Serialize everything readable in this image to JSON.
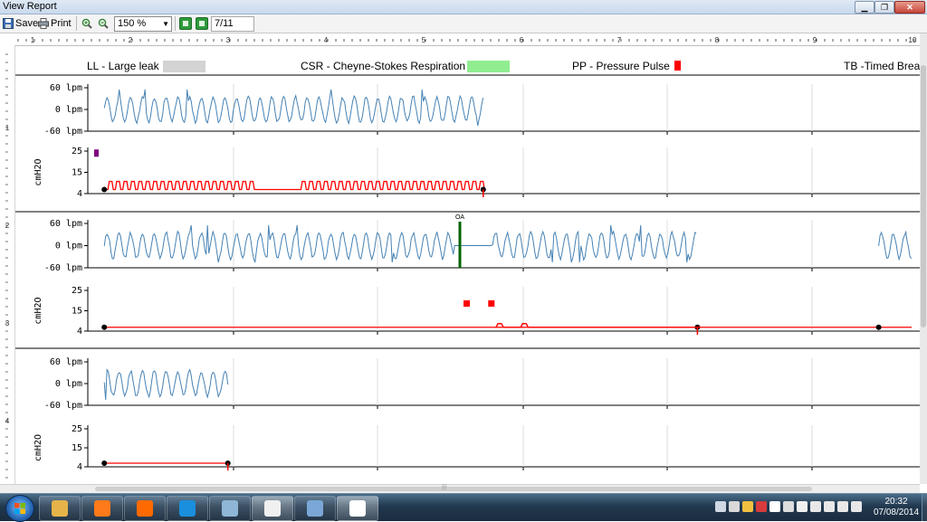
{
  "window": {
    "title": "View Report",
    "minimize_glyph": "▁",
    "maximize_glyph": "❐",
    "close_glyph": "✕"
  },
  "toolbar": {
    "save_label": "Save",
    "print_label": "Print",
    "zoom_in_icon": "zoom-in-icon",
    "zoom_out_icon": "zoom-out-icon",
    "zoom_value": "150 %",
    "page_indicator": "7/11"
  },
  "ruler": {
    "horizontal_labels": [
      "1",
      "2",
      "3",
      "4",
      "5",
      "6",
      "7",
      "8",
      "9",
      "10"
    ],
    "vertical_labels": [
      "1",
      "2",
      "3",
      "4"
    ]
  },
  "legend": [
    {
      "label": "LL - Large leak",
      "color": "#d3d3d3"
    },
    {
      "label": "CSR - Cheyne-Stokes Respiration",
      "color": "#90ee90"
    },
    {
      "label": "PP - Pressure Pulse",
      "color": "#ff0000"
    },
    {
      "label": "TB -Timed Brea",
      "color": ""
    }
  ],
  "charts": {
    "flow_ticks": [
      "60 lpm",
      "0 lpm",
      "-60 lpm"
    ],
    "pressure_ticks": [
      "25",
      "15",
      "4"
    ],
    "pressure_unit": "cmH2O",
    "flow_color": "#4682b4",
    "pressure_color": "#ff0000",
    "event_label": "OA",
    "event_color": "#006400",
    "marker_color": "#800080"
  },
  "chart_data": [
    {
      "type": "line",
      "name": "Flow row 1",
      "ylim": [
        -60,
        60
      ],
      "segments": [
        [
          0.02,
          0.48
        ]
      ]
    },
    {
      "type": "line",
      "name": "Pressure row 1",
      "ylim": [
        4,
        25
      ],
      "segments": [
        [
          0.02,
          0.48
        ]
      ],
      "baseline": 6,
      "peak": 10,
      "marker": {
        "x": 0.03,
        "y": 24
      }
    },
    {
      "type": "line",
      "name": "Flow row 2",
      "ylim": [
        -60,
        60
      ],
      "segments": [
        [
          0.02,
          0.74
        ],
        [
          0.96,
          1.0
        ]
      ],
      "events": [
        {
          "label": "OA",
          "x": 0.5
        }
      ]
    },
    {
      "type": "line",
      "name": "Pressure row 2",
      "ylim": [
        4,
        25
      ],
      "segments": [
        [
          0.02,
          0.74
        ],
        [
          0.96,
          1.0
        ]
      ],
      "baseline": 6,
      "pulses": [
        0.5,
        0.53
      ]
    },
    {
      "type": "line",
      "name": "Flow row 3",
      "ylim": [
        -60,
        60
      ],
      "segments": [
        [
          0.02,
          0.17
        ]
      ]
    },
    {
      "type": "line",
      "name": "Pressure row 3",
      "ylim": [
        4,
        25
      ],
      "segments": [
        [
          0.02,
          0.17
        ]
      ],
      "baseline": 6
    }
  ],
  "taskbar": {
    "apps": [
      "file-explorer-icon",
      "media-player-icon",
      "office-icon",
      "internet-explorer-icon",
      "remote-desktop-icon",
      "sheep-app-icon",
      "paint-icon",
      "report-viewer-icon"
    ],
    "clock_time": "20:32",
    "clock_date": "07/08/2014"
  }
}
